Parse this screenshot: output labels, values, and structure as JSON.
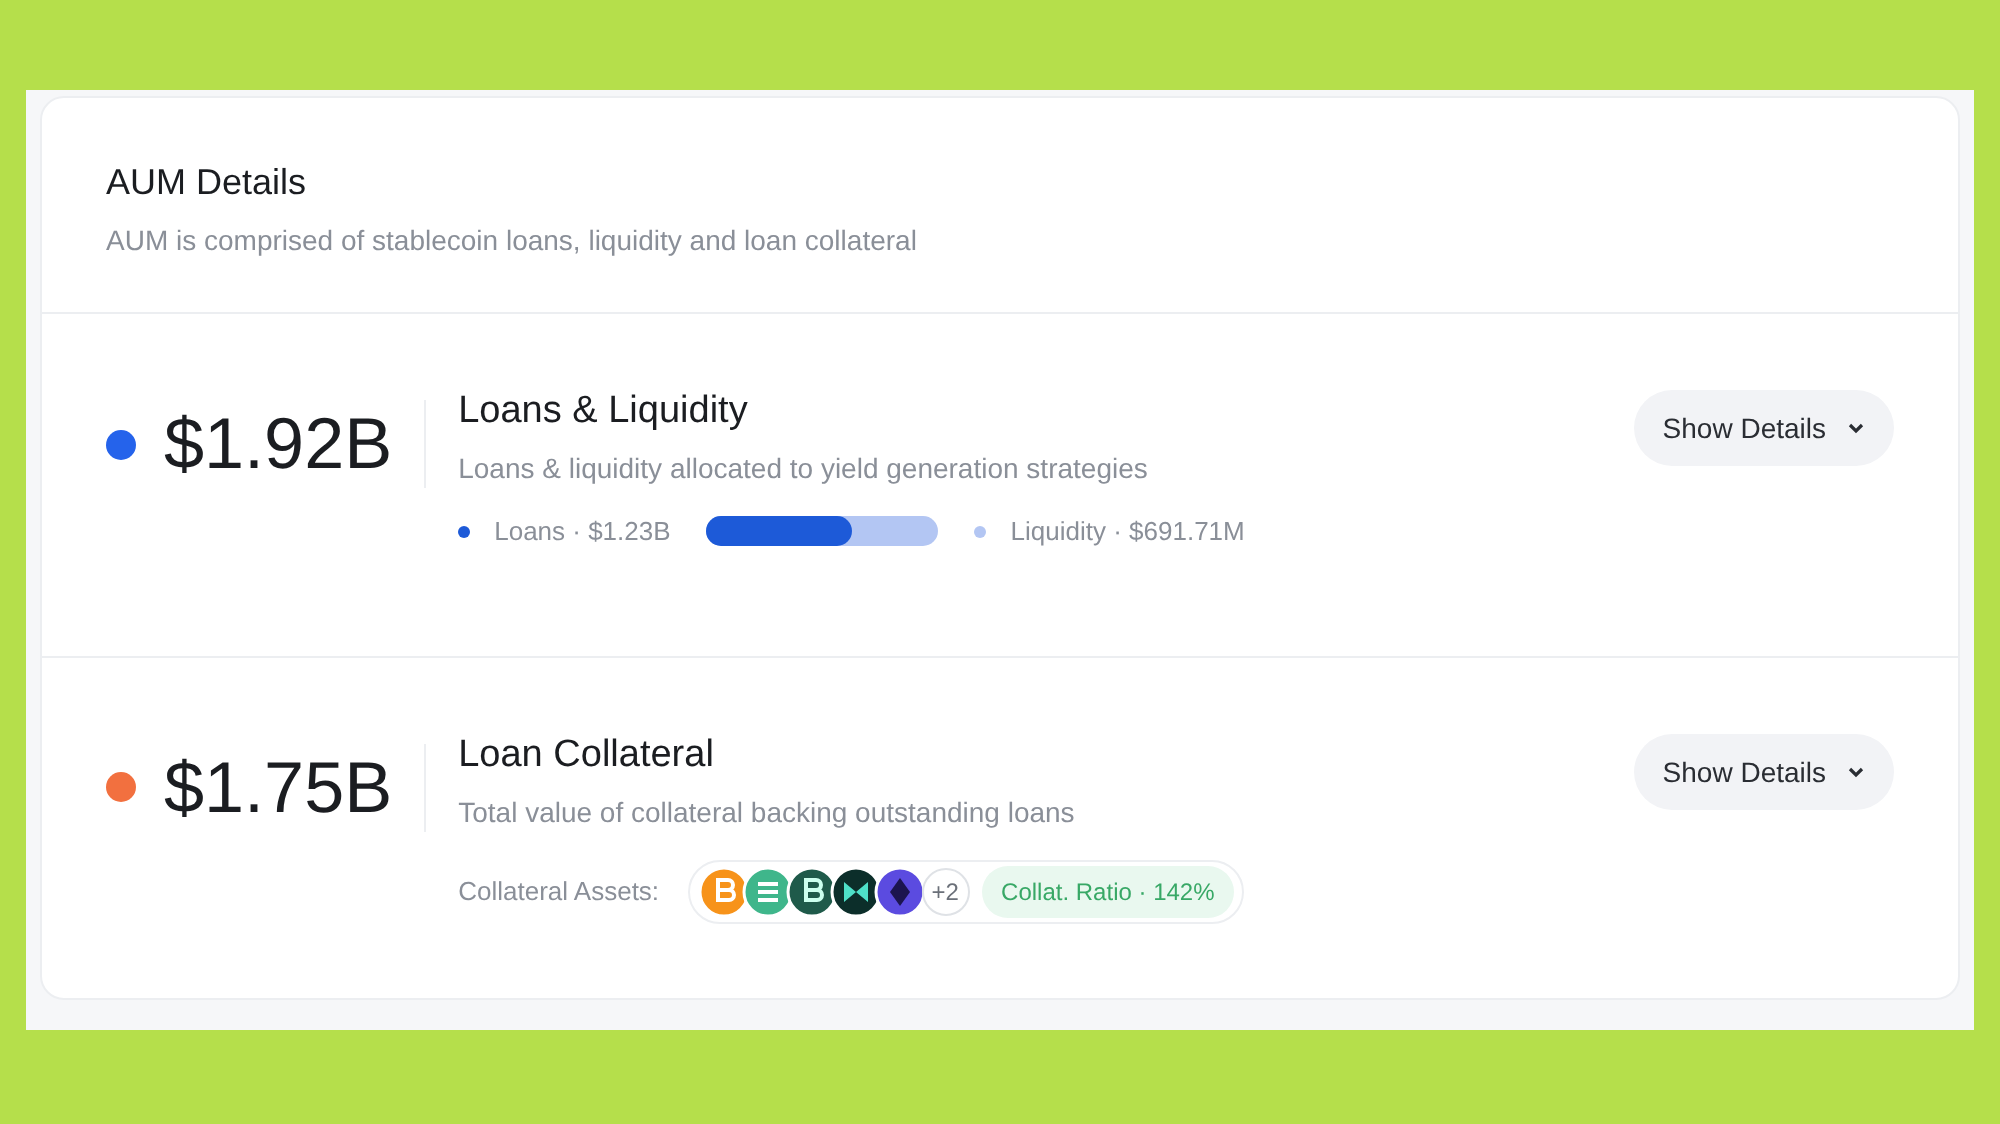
{
  "header": {
    "title": "AUM Details",
    "subtitle": "AUM is comprised of stablecoin loans, liquidity and loan collateral"
  },
  "sections": [
    {
      "kind": "loans",
      "color": "#2563eb",
      "amount": "$1.92B",
      "title": "Loans & Liquidity",
      "description": "Loans & liquidity allocated to yield generation strategies",
      "button": "Show Details",
      "legend": [
        {
          "label": "Loans · $1.23B",
          "color": "#1d5ad8"
        },
        {
          "label": "Liquidity · $691.71M",
          "color": "#b3c6f3"
        }
      ],
      "level": 0.63
    },
    {
      "kind": "collateral",
      "color": "#f2703f",
      "amount": "$1.75B",
      "title": "Loan Collateral",
      "description": "Total value of collateral backing outstanding loans",
      "button": "Show Details",
      "assets_label": "Collateral Assets:",
      "assets": [
        {
          "color": "#f7931a"
        },
        {
          "color": "#3fb68b"
        },
        {
          "color": "#1f5a4a"
        },
        {
          "color": "#0c2e2a"
        },
        {
          "color": "#5b4be0"
        }
      ],
      "more": "+2",
      "ratio": "Collat. Ratio · 142%"
    }
  ]
}
